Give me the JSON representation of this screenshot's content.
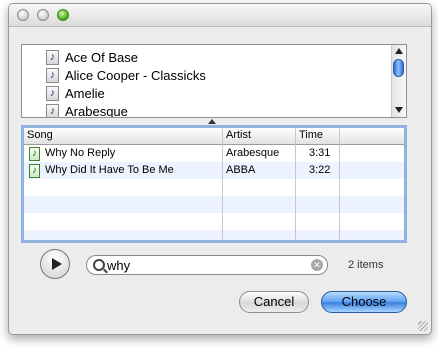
{
  "artists": [
    {
      "label": "Ace Of Base"
    },
    {
      "label": "Alice Cooper - Classicks"
    },
    {
      "label": "Amelie"
    },
    {
      "label": "Arabesque"
    }
  ],
  "table": {
    "columns": [
      "Song",
      "Artist",
      "Time"
    ],
    "rows": [
      {
        "song": "Why No Reply",
        "artist": "Arabesque",
        "time": "3:31"
      },
      {
        "song": "Why Did It Have To Be Me",
        "artist": "ABBA",
        "time": "3:22"
      }
    ]
  },
  "search": {
    "value": "why"
  },
  "status": {
    "items": "2 items"
  },
  "buttons": {
    "cancel": "Cancel",
    "choose": "Choose"
  },
  "icons": {
    "play": "play-icon",
    "search": "search-icon",
    "clear": "clear-icon",
    "note": "music-note-icon"
  },
  "colors": {
    "accent": "#3a7fe0",
    "table_focus": "#8fb3e0",
    "stripe": "#edf3fe"
  }
}
